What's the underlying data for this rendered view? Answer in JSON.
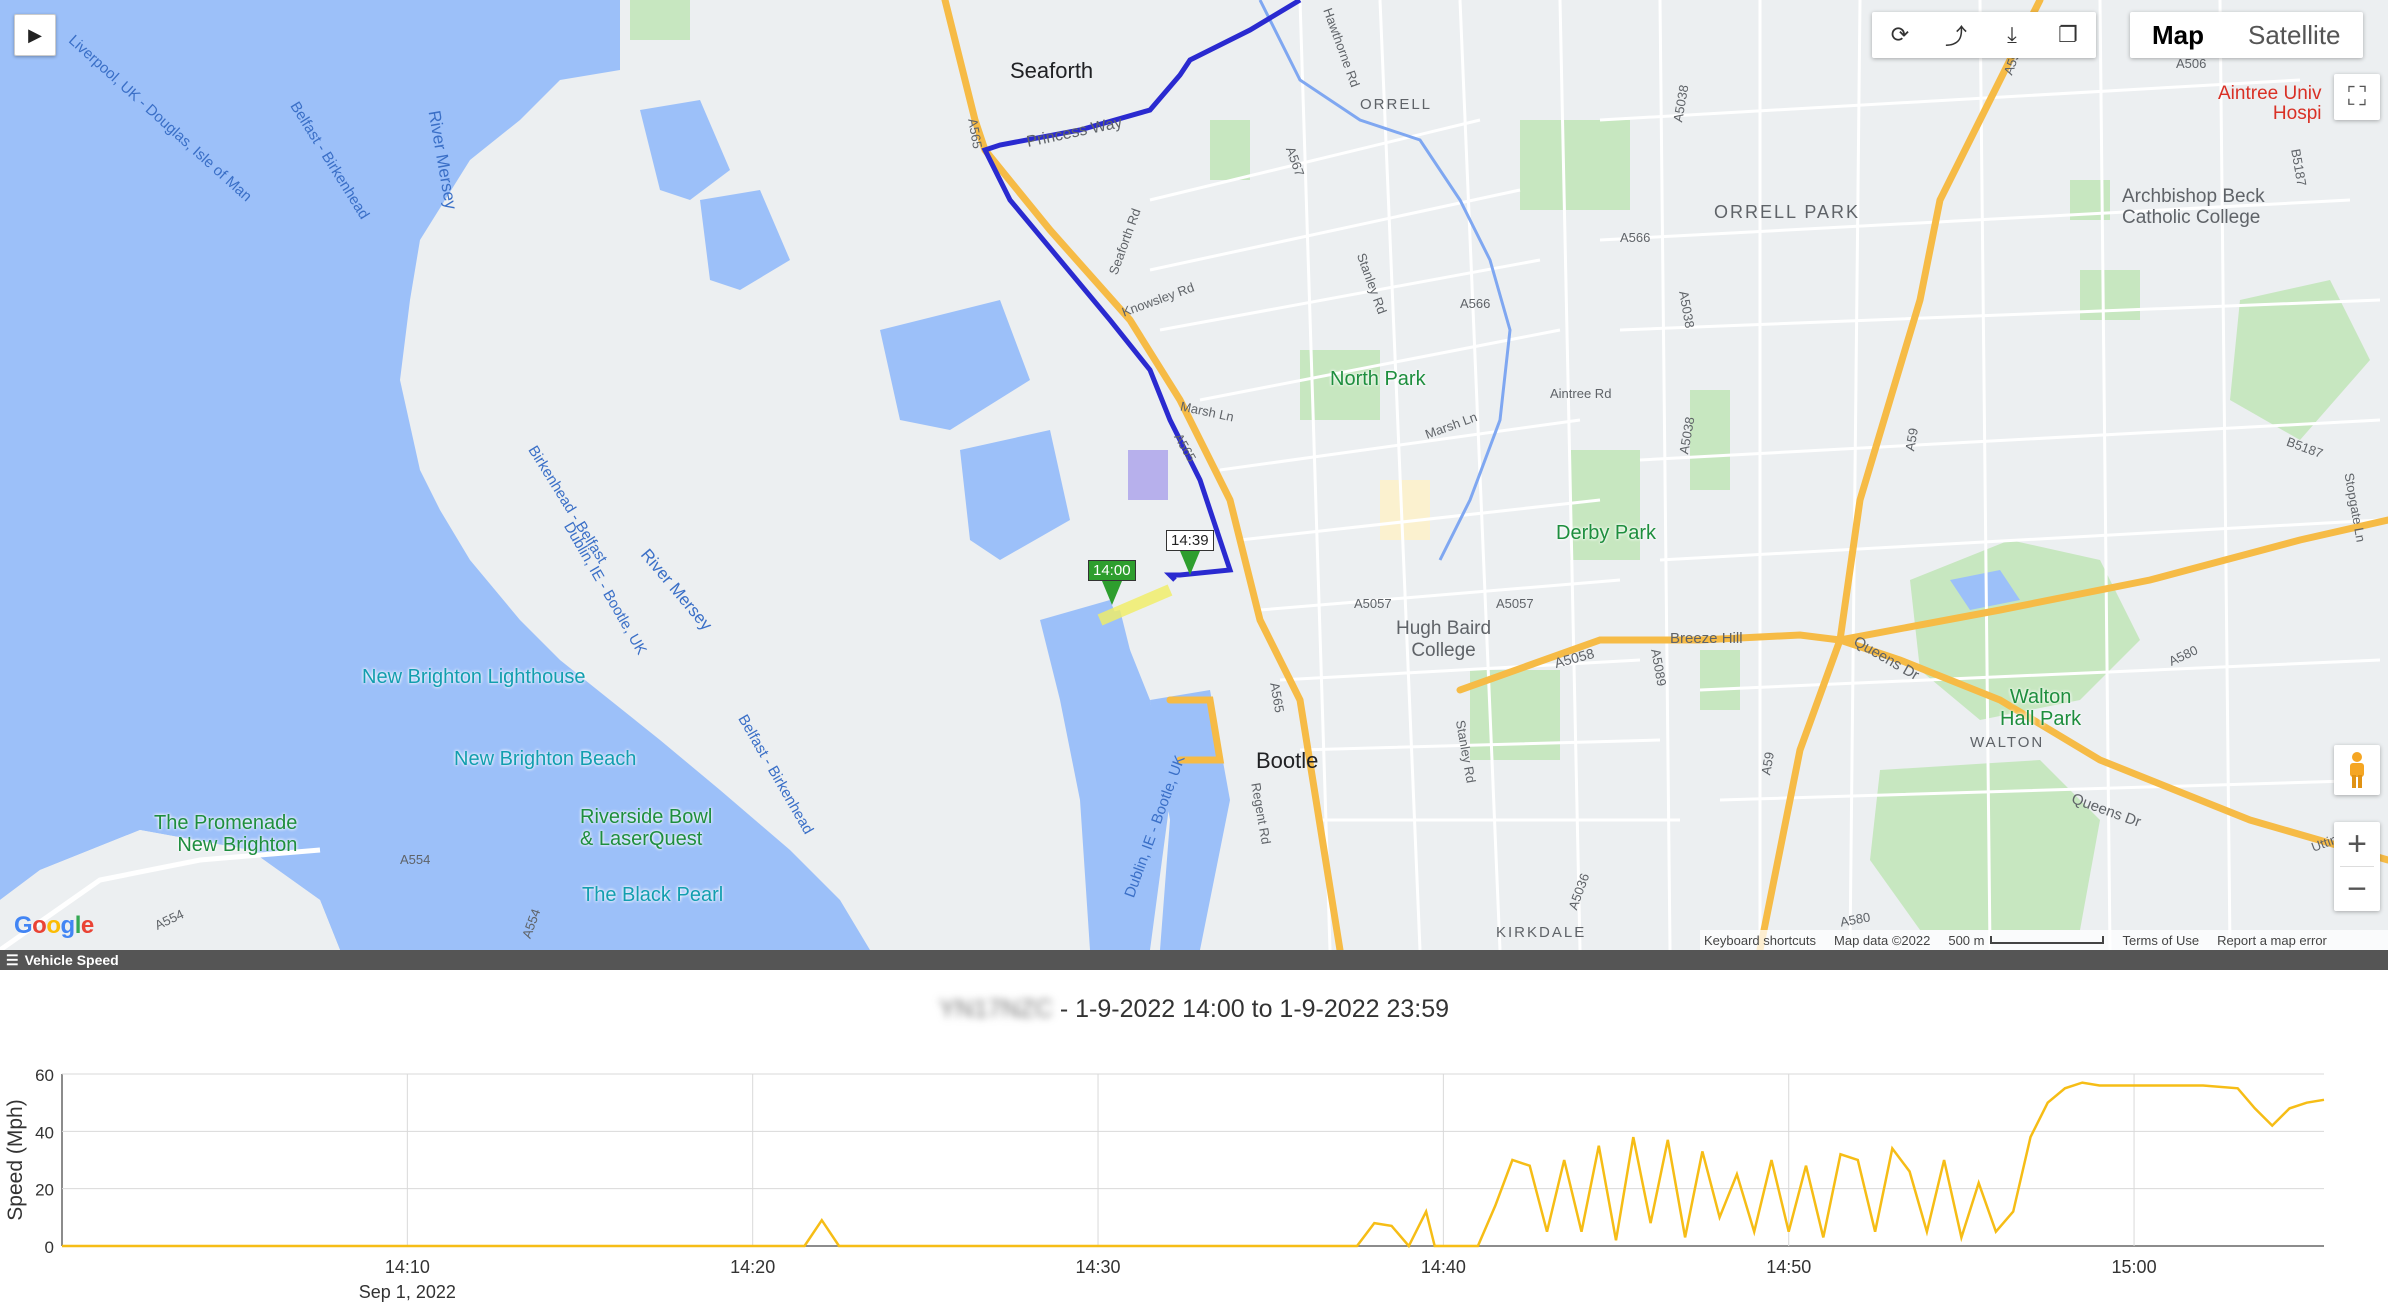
{
  "map": {
    "play_icon": "play-icon",
    "toolbar_icons": [
      "refresh-icon",
      "share-icon",
      "download-icon",
      "layers-icon"
    ],
    "map_type": {
      "map_label": "Map",
      "satellite_label": "Satellite",
      "active": "Map"
    },
    "fullscreen_icon": "fullscreen-icon",
    "pegman_icon": "pegman-icon",
    "zoom_in_label": "+",
    "zoom_out_label": "−",
    "google_logo": "Google",
    "attribution": {
      "keyboard": "Keyboard shortcuts",
      "map_data": "Map data ©2022",
      "scale": "500 m",
      "terms": "Terms of Use",
      "report": "Report a map error"
    },
    "places": {
      "seaforth": "Seaforth",
      "orrell": "ORRELL",
      "orrell_park": "ORRELL PARK",
      "bootle": "Bootle",
      "walton": "WALTON",
      "kirkdale": "KIRKDALE",
      "north_park": "North Park",
      "derby_park": "Derby Park",
      "walton_hall_park": "Walton\nHall Park",
      "hugh_baird": "Hugh Baird\nCollege",
      "archbishop": "Archbishop Beck\nCatholic College",
      "aintree": "Aintree Univ\nHospi",
      "lighthouse": "New Brighton Lighthouse",
      "beach": "New Brighton Beach",
      "promenade": "The Promenade\nNew Brighton",
      "riverside": "Riverside Bowl\n& LaserQuest",
      "black_pearl": "The Black Pearl",
      "river_mersey_1": "River Mersey",
      "river_mersey_2": "River Mersey"
    },
    "roads": {
      "princess_way": "Princess Way",
      "hawthorne": "Hawthorne Rd",
      "seaforth_rd": "Seaforth Rd",
      "knowsley": "Knowsley Rd",
      "stanley_rd": "Stanley Rd",
      "stanley_rd2": "Stanley Rd",
      "marsh_ln": "Marsh Ln",
      "marsh_ln2": "Marsh Ln",
      "aintree_rd": "Aintree Rd",
      "breeze_hill": "Breeze Hill",
      "queens_dr": "Queens Dr",
      "queens_dr2": "Queens Dr",
      "regent_rd": "Regent Rd",
      "utting": "Utting Ave",
      "stopgate": "Stopgate Ln",
      "a565_1": "A565",
      "a565_2": "A565",
      "a565_3": "A565",
      "a567": "A567",
      "a566_1": "A566",
      "a566_2": "A566",
      "a5038_1": "A5038",
      "a5038_2": "A5038",
      "a5038_3": "A5038",
      "a5057_1": "A5057",
      "a5057_2": "A5057",
      "a5058": "A5058",
      "a59_1": "A59",
      "a59_2": "A59",
      "a59_3": "A59",
      "a580_1": "A580",
      "a580_2": "A580",
      "a554_1": "A554",
      "a554_2": "A554",
      "a554_3": "A554",
      "a506": "A506",
      "b5187": "B5187",
      "b5187_2": "B5187",
      "a5036": "A5036",
      "a5089": "A5089"
    },
    "ferries": {
      "liverpool_douglas": "Liverpool, UK - Douglas, Isle of Man",
      "belfast_birk": "Belfast - Birkenhead",
      "birk_belfast": "Birkenhead - Belfast",
      "dublin_bootle": "Dublin, IE - Bootle, UK",
      "belfast_birk2": "Belfast - Birkenhead",
      "dublin_bootle2": "Dublin, IE - Bootle, UK"
    },
    "markers": {
      "start_time": "14:00",
      "end_time": "14:39",
      "start_color": "#2e9e2e",
      "end_color": "#ffffff"
    },
    "colors": {
      "water": "#9cc0f9",
      "route": "#2a2ad0",
      "highway": "#f6bb46",
      "park": "#c7e7c0"
    }
  },
  "panel": {
    "menu_icon": "menu-icon",
    "title": "Vehicle Speed"
  },
  "chart_title": {
    "vehicle": "YN17NZC",
    "range": " - 1-9-2022 14:00 to 1-9-2022 23:59"
  },
  "chart_data": {
    "type": "line",
    "title": "YN17NZC - 1-9-2022 14:00 to 1-9-2022 23:59",
    "xlabel": "",
    "ylabel": "Speed (Mph)",
    "ylim": [
      0,
      60
    ],
    "yticks": [
      0,
      20,
      40,
      60
    ],
    "xlim": [
      "14:00:00",
      "15:05:30"
    ],
    "xticks": [
      "14:10",
      "14:20",
      "14:30",
      "14:40",
      "14:50",
      "15:00"
    ],
    "xtick_sublabel": {
      "tick": "14:10",
      "label": "Sep 1, 2022"
    },
    "grid": true,
    "color": "#f6bd16",
    "series": [
      {
        "name": "Speed",
        "points": [
          [
            "14:00:00",
            0
          ],
          [
            "14:21:30",
            0
          ],
          [
            "14:22:00",
            9
          ],
          [
            "14:22:30",
            0
          ],
          [
            "14:37:30",
            0
          ],
          [
            "14:38:00",
            8
          ],
          [
            "14:38:30",
            7
          ],
          [
            "14:39:00",
            0
          ],
          [
            "14:39:30",
            12
          ],
          [
            "14:39:45",
            0
          ],
          [
            "14:41:00",
            0
          ],
          [
            "14:41:30",
            14
          ],
          [
            "14:42:00",
            30
          ],
          [
            "14:42:30",
            28
          ],
          [
            "14:43:00",
            5
          ],
          [
            "14:43:30",
            30
          ],
          [
            "14:44:00",
            5
          ],
          [
            "14:44:30",
            35
          ],
          [
            "14:45:00",
            2
          ],
          [
            "14:45:30",
            38
          ],
          [
            "14:46:00",
            8
          ],
          [
            "14:46:30",
            37
          ],
          [
            "14:47:00",
            3
          ],
          [
            "14:47:30",
            33
          ],
          [
            "14:48:00",
            10
          ],
          [
            "14:48:30",
            25
          ],
          [
            "14:49:00",
            5
          ],
          [
            "14:49:30",
            30
          ],
          [
            "14:50:00",
            5
          ],
          [
            "14:50:30",
            28
          ],
          [
            "14:51:00",
            3
          ],
          [
            "14:51:30",
            32
          ],
          [
            "14:52:00",
            30
          ],
          [
            "14:52:30",
            5
          ],
          [
            "14:53:00",
            34
          ],
          [
            "14:53:30",
            26
          ],
          [
            "14:54:00",
            5
          ],
          [
            "14:54:30",
            30
          ],
          [
            "14:55:00",
            3
          ],
          [
            "14:55:30",
            22
          ],
          [
            "14:56:00",
            5
          ],
          [
            "14:56:30",
            12
          ],
          [
            "14:57:00",
            38
          ],
          [
            "14:57:30",
            50
          ],
          [
            "14:58:00",
            55
          ],
          [
            "14:58:30",
            57
          ],
          [
            "14:59:00",
            56
          ],
          [
            "15:00:00",
            56
          ],
          [
            "15:01:00",
            56
          ],
          [
            "15:02:00",
            56
          ],
          [
            "15:03:00",
            55
          ],
          [
            "15:03:30",
            48
          ],
          [
            "15:04:00",
            42
          ],
          [
            "15:04:30",
            48
          ],
          [
            "15:05:00",
            50
          ],
          [
            "15:05:30",
            51
          ]
        ]
      }
    ]
  }
}
